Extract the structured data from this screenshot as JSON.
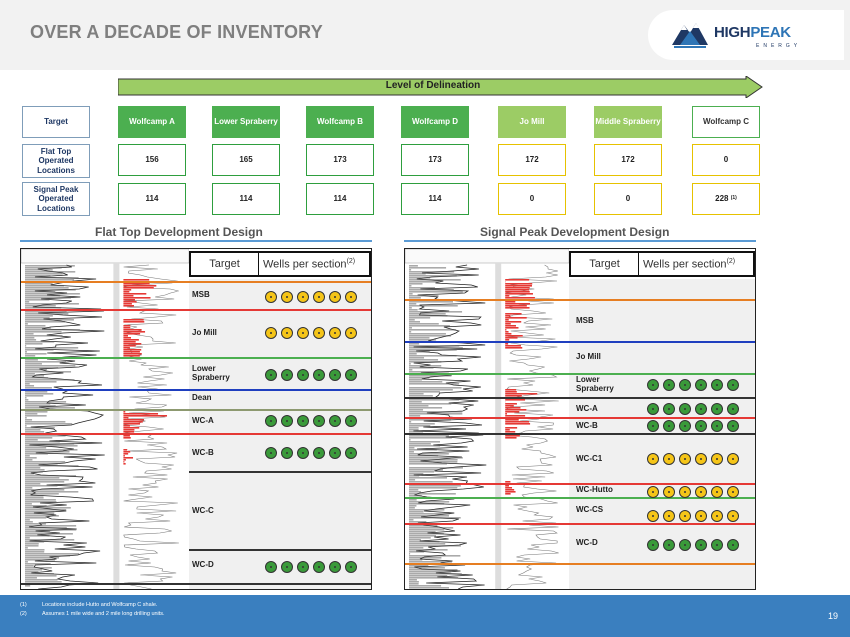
{
  "header": {
    "title": "OVER A DECADE OF INVENTORY",
    "logo_high": "HIGH",
    "logo_peak": "PEAK",
    "logo_energy": "ENERGY"
  },
  "delineation": {
    "label": "Level of Delineation"
  },
  "inventory": {
    "row_labels": [
      "Target",
      "Flat Top Operated Locations",
      "Signal Peak Operated Locations"
    ],
    "targets": [
      "Wolfcamp A",
      "Lower Spraberry",
      "Wolfcamp B",
      "Wolfcamp D",
      "Jo Mill",
      "Middle Spraberry",
      "Wolfcamp C"
    ],
    "flat_top": [
      "156",
      "165",
      "173",
      "173",
      "172",
      "172",
      "0"
    ],
    "signal_peak": [
      "114",
      "114",
      "114",
      "114",
      "0",
      "0",
      "228"
    ],
    "footnote_ref": "(1)"
  },
  "flat_top": {
    "section_title": "Flat Top Development Design",
    "col_target": "Target",
    "col_wells": "Wells per section",
    "col_wells_ref": "(2)",
    "zones": [
      "MSB",
      "Jo Mill",
      "Lower Spraberry",
      "Dean",
      "WC-A",
      "WC-B",
      "WC-C",
      "WC-D"
    ]
  },
  "signal_peak": {
    "section_title": "Signal Peak Development Design",
    "col_target": "Target",
    "col_wells": "Wells per section",
    "col_wells_ref": "(2)",
    "zones": [
      "MSB",
      "Jo Mill",
      "Lower Spraberry",
      "WC-A",
      "WC-B",
      "WC-C1",
      "WC-Hutto",
      "WC-CS",
      "WC-D"
    ]
  },
  "footer": {
    "notes": [
      {
        "num": "(1)",
        "text": "Locations include Hutto and Wolfcamp C shale."
      },
      {
        "num": "(2)",
        "text": "Assumes 1 mile wide and 2 mile long drilling units."
      }
    ],
    "page": "19"
  },
  "colors": {
    "header_bg": "#f2f2f2",
    "footer_bg": "#3a7fbf",
    "green": "#4caf50",
    "light_green": "#9ccc65",
    "yellow_well": "#f5c518",
    "green_well": "#3a9a3a"
  }
}
